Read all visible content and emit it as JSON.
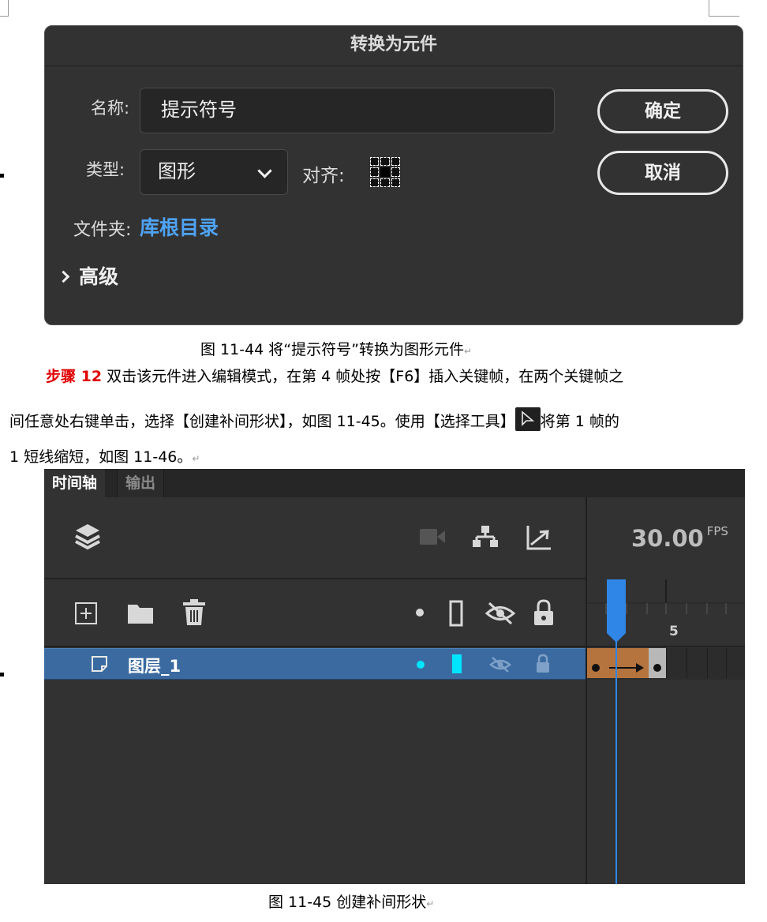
{
  "dialog": {
    "title": "转换为元件",
    "name_label": "名称:",
    "name_value": "提示符号",
    "type_label": "类型:",
    "type_value": "图形",
    "align_label": "对齐:",
    "folder_label": "文件夹:",
    "folder_value": "库根目录",
    "advanced_label": "高级",
    "ok_button": "确定",
    "cancel_button": "取消"
  },
  "doc": {
    "caption1": "图 11-44 将“提示符号”转换为图形元件",
    "step_label": "步骤 12",
    "para_line1": " 双击该元件进入编辑模式，在第 4 帧处按【F6】插入关键帧，在两个关键帧之",
    "para_line2_a": "间任意处右键单击，选择【创建补间形状】，如图 11-45。使用【选择工具】",
    "para_line2_b": "将第 1 帧的",
    "para_line3": "1 短线缩短，如图 11-46。",
    "caption2": "图 11-45 创建补间形状",
    "paragraph_mark": "↵"
  },
  "timeline": {
    "tabs": [
      "时间轴",
      "输出"
    ],
    "fps_value": "30.00",
    "fps_unit": "FPS",
    "frame_number": "5",
    "layer_name": "图层_1",
    "playhead_frame": 2,
    "tween_span": [
      1,
      4
    ],
    "accent_color": "#2f86e6",
    "selected_layer_color": "#3a6aa0",
    "tween_color": "#b5743e"
  }
}
